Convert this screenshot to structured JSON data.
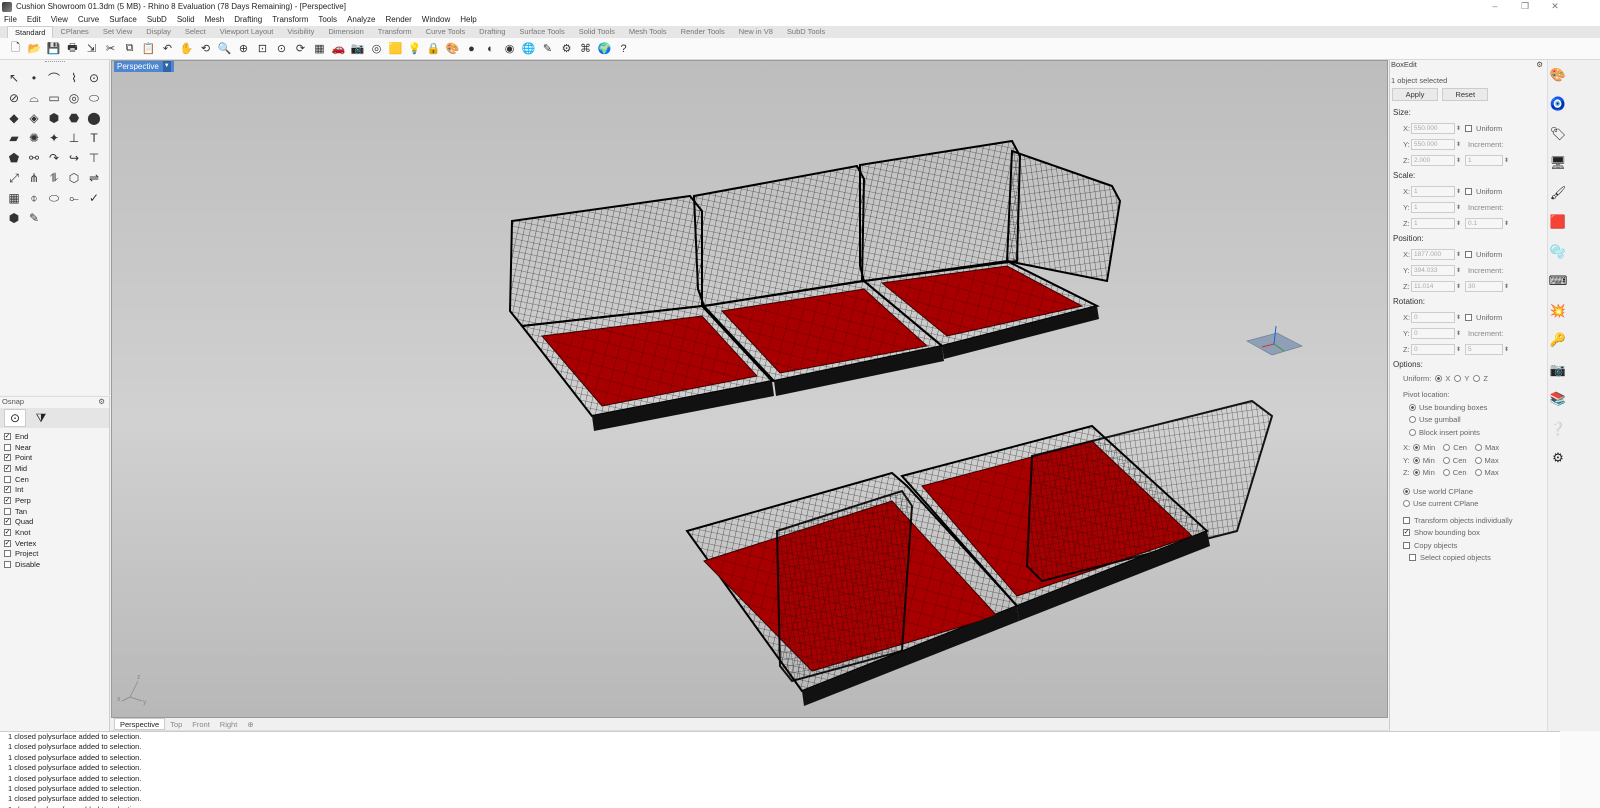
{
  "window": {
    "title": "Cushion Showroom 01.3dm (5 MB) - Rhino 8 Evaluation (78 Days Remaining) - [Perspective]",
    "minimize": "–",
    "maximize": "❐",
    "close": "✕"
  },
  "menu": [
    "File",
    "Edit",
    "View",
    "Curve",
    "Surface",
    "SubD",
    "Solid",
    "Mesh",
    "Drafting",
    "Transform",
    "Tools",
    "Analyze",
    "Render",
    "Window",
    "Help"
  ],
  "toolbar_tabs": [
    "Standard",
    "CPlanes",
    "Set View",
    "Display",
    "Select",
    "Viewport Layout",
    "Visibility",
    "Dimension",
    "Transform",
    "Curve Tools",
    "Drafting",
    "Surface Tools",
    "Solid Tools",
    "Mesh Tools",
    "Render Tools",
    "New in V8",
    "SubD Tools"
  ],
  "active_tab": "Standard",
  "toolbar_icons": [
    "new-icon",
    "open-icon",
    "save-icon",
    "print-icon",
    "import-icon",
    "cut-icon",
    "copy-icon",
    "paste-icon",
    "undo-icon",
    "pan-icon",
    "rotate-icon",
    "zoom-icon",
    "zoom-window-icon",
    "zoom-extents-icon",
    "zoom-selected-icon",
    "named-view-icon",
    "viewport-layout-icon",
    "car-icon",
    "camera-icon",
    "target-icon",
    "layer-icon",
    "light-icon",
    "lock-icon",
    "material-icon",
    "color-wheel-icon",
    "sphere-icon",
    "render-icon",
    "globe-icon",
    "annotate-icon",
    "gear-icon",
    "tree-icon",
    "web-icon",
    "help-icon"
  ],
  "toolbar_glyphs": [
    "🗋",
    "📂",
    "💾",
    "🖶",
    "⇲",
    "✂",
    "⧉",
    "📋",
    "↶",
    "✋",
    "⟲",
    "🔍",
    "⊕",
    "⊡",
    "⊙",
    "⟳",
    "▦",
    "🚗",
    "📷",
    "◎",
    "🟨",
    "💡",
    "🔒",
    "🎨",
    "●",
    "◐",
    "◉",
    "🌐",
    "✎",
    "⚙",
    "⌘",
    "🌍",
    "?"
  ],
  "left_tools": [
    "↖",
    "•",
    "⌒",
    "⌇",
    "⊙",
    "⊘",
    "⌓",
    "▭",
    "◎",
    "⬭",
    "◆",
    "◈",
    "⬢",
    "⬣",
    "⬤",
    "▰",
    "✺",
    "✦",
    "⊥",
    "T",
    "⬟",
    "⚯",
    "↷",
    "↪",
    "⊤",
    "⤢",
    "⋔",
    "⥮",
    "⬡",
    "⇌",
    "▦",
    "⌽",
    "⬭",
    "⟜",
    "✓",
    "⬢",
    "✎"
  ],
  "osnap": {
    "title": "Osnap",
    "items": [
      {
        "label": "End",
        "checked": true
      },
      {
        "label": "Near",
        "checked": false
      },
      {
        "label": "Point",
        "checked": true
      },
      {
        "label": "Mid",
        "checked": true
      },
      {
        "label": "Cen",
        "checked": false
      },
      {
        "label": "Int",
        "checked": true
      },
      {
        "label": "Perp",
        "checked": true
      },
      {
        "label": "Tan",
        "checked": false
      },
      {
        "label": "Quad",
        "checked": true
      },
      {
        "label": "Knot",
        "checked": true
      },
      {
        "label": "Vertex",
        "checked": true
      },
      {
        "label": "Project",
        "checked": false
      },
      {
        "label": "Disable",
        "checked": false
      }
    ]
  },
  "viewport": {
    "label": "Perspective",
    "axes": {
      "x": "x",
      "y": "y",
      "z": "z"
    }
  },
  "viewport_tabs": [
    "Perspective",
    "Top",
    "Front",
    "Right"
  ],
  "command_history": [
    "1 closed polysurface added to selection.",
    "1 closed polysurface added to selection.",
    "1 closed polysurface added to selection.",
    "1 closed polysurface added to selection.",
    "1 closed polysurface added to selection.",
    "1 closed polysurface added to selection.",
    "1 closed polysurface added to selection.",
    "1 closed polysurface added to selection."
  ],
  "boxedit": {
    "title": "BoxEdit",
    "status": "1 object selected",
    "apply": "Apply",
    "reset": "Reset",
    "uniform": "Uniform",
    "increment": "Increment:",
    "size": {
      "label": "Size:",
      "x": "550.000",
      "y": "550.000",
      "z": "2.000",
      "inc": "1"
    },
    "scale": {
      "label": "Scale:",
      "x": "1",
      "y": "1",
      "z": "1",
      "inc": "0.1"
    },
    "position": {
      "label": "Position:",
      "x": "1877.000",
      "y": "394.033",
      "z": "11.014",
      "inc": "30"
    },
    "rotation": {
      "label": "Rotation:",
      "x": "0",
      "y": "0",
      "z": "0",
      "inc": "5"
    },
    "options": {
      "label": "Options:",
      "uniform_label": "Uniform:",
      "pivot_label": "Pivot location:",
      "use_bounding": "Use bounding boxes",
      "use_gumball": "Use gumball",
      "block_insert": "Block insert points",
      "min": "Min",
      "cen": "Cen",
      "max": "Max",
      "world_cplane": "Use world CPlane",
      "current_cplane": "Use current CPlane",
      "transform_individually": "Transform objects individually",
      "show_bbox": "Show bounding box",
      "copy_objects": "Copy objects",
      "select_copied": "Select copied objects"
    }
  },
  "right_strip": [
    "🎨",
    "🧿",
    "🏷",
    "🖥",
    "🖌",
    "🟥",
    "🫧",
    "⌨",
    "💥",
    "🔑",
    "📷",
    "📚",
    "❔",
    "⚙"
  ],
  "colors": {
    "accent": "#4f86d0",
    "cushion_red": "#b00000",
    "wire": "#111111"
  }
}
